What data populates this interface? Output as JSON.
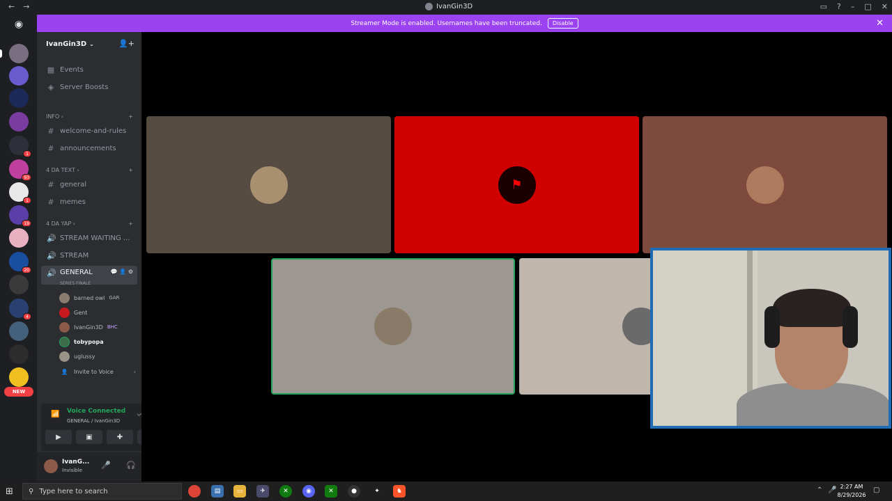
{
  "window": {
    "title": "IvanGin3D",
    "back_icon": "arrow-left",
    "forward_icon": "arrow-right"
  },
  "banner": {
    "text": "Streamer Mode is enabled. Usernames have been truncated.",
    "button": "Disable"
  },
  "guilds": {
    "badges": [
      "",
      "1",
      "93",
      "1",
      "19",
      "20",
      "4"
    ],
    "new_label": "NEW"
  },
  "server": {
    "name": "IvanGin3D"
  },
  "sidebar": {
    "events": "Events",
    "boosts": "Server Boosts",
    "categories": [
      {
        "name": "INFO",
        "channels": [
          "welcome-and-rules",
          "announcements"
        ]
      },
      {
        "name": "4 DA TEXT",
        "channels": [
          "general",
          "memes"
        ]
      },
      {
        "name": "4 DA YAP",
        "channels": [
          "STREAM WAITING ...",
          "STREAM",
          "GENERAL"
        ]
      }
    ],
    "active_channel_topic": "SERIES FINALE",
    "voice_users": [
      {
        "name": "barned owl",
        "tag": "GAR"
      },
      {
        "name": "Gent",
        "tag": ""
      },
      {
        "name": "IvanGin3D",
        "tag": "BHC"
      },
      {
        "name": "tobypopa",
        "tag": ""
      },
      {
        "name": "uglussy",
        "tag": ""
      }
    ],
    "invite": "Invite to Voice"
  },
  "voice": {
    "status": "Voice Connected",
    "location": "GENERAL / IvanGin3D"
  },
  "user": {
    "name": "IvanG...",
    "status": "Invisible"
  },
  "taskbar": {
    "search_placeholder": "Type here to search",
    "time": "2:27 AM",
    "date": "8/29/2026"
  },
  "colors": {
    "accent": "#9b43f0",
    "connected": "#23a55a",
    "tile_red": "#d00000",
    "tile_brown": "#574c42",
    "tile_rust": "#7d4a3d",
    "tile_grey": "#9c9790",
    "tile_beige": "#c1b6ab"
  }
}
